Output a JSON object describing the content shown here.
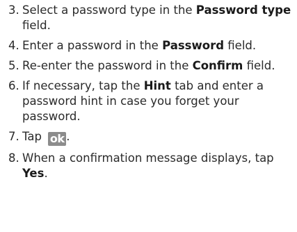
{
  "steps": [
    {
      "num": "3.",
      "pre": "Select a password type in the ",
      "bold": "Password type",
      "post": " field."
    },
    {
      "num": "4.",
      "pre": "Enter a password in the ",
      "bold": "Password",
      "post": " field."
    },
    {
      "num": "5.",
      "pre": "Re-enter the password in the ",
      "bold": "Confirm",
      "post": " field."
    },
    {
      "num": "6.",
      "pre": "If necessary, tap the ",
      "bold": "Hint",
      "post": " tab and enter a password hint in case you forget your password."
    },
    {
      "num": "7.",
      "pre": "Tap ",
      "icon_label": "ok",
      "post": "."
    },
    {
      "num": "8.",
      "pre": "When a confirmation message displays, tap ",
      "bold": "Yes",
      "post": "."
    }
  ],
  "icons": {
    "ok_button": {
      "name": "ok-button-icon",
      "color": "#8c8c8c"
    }
  }
}
